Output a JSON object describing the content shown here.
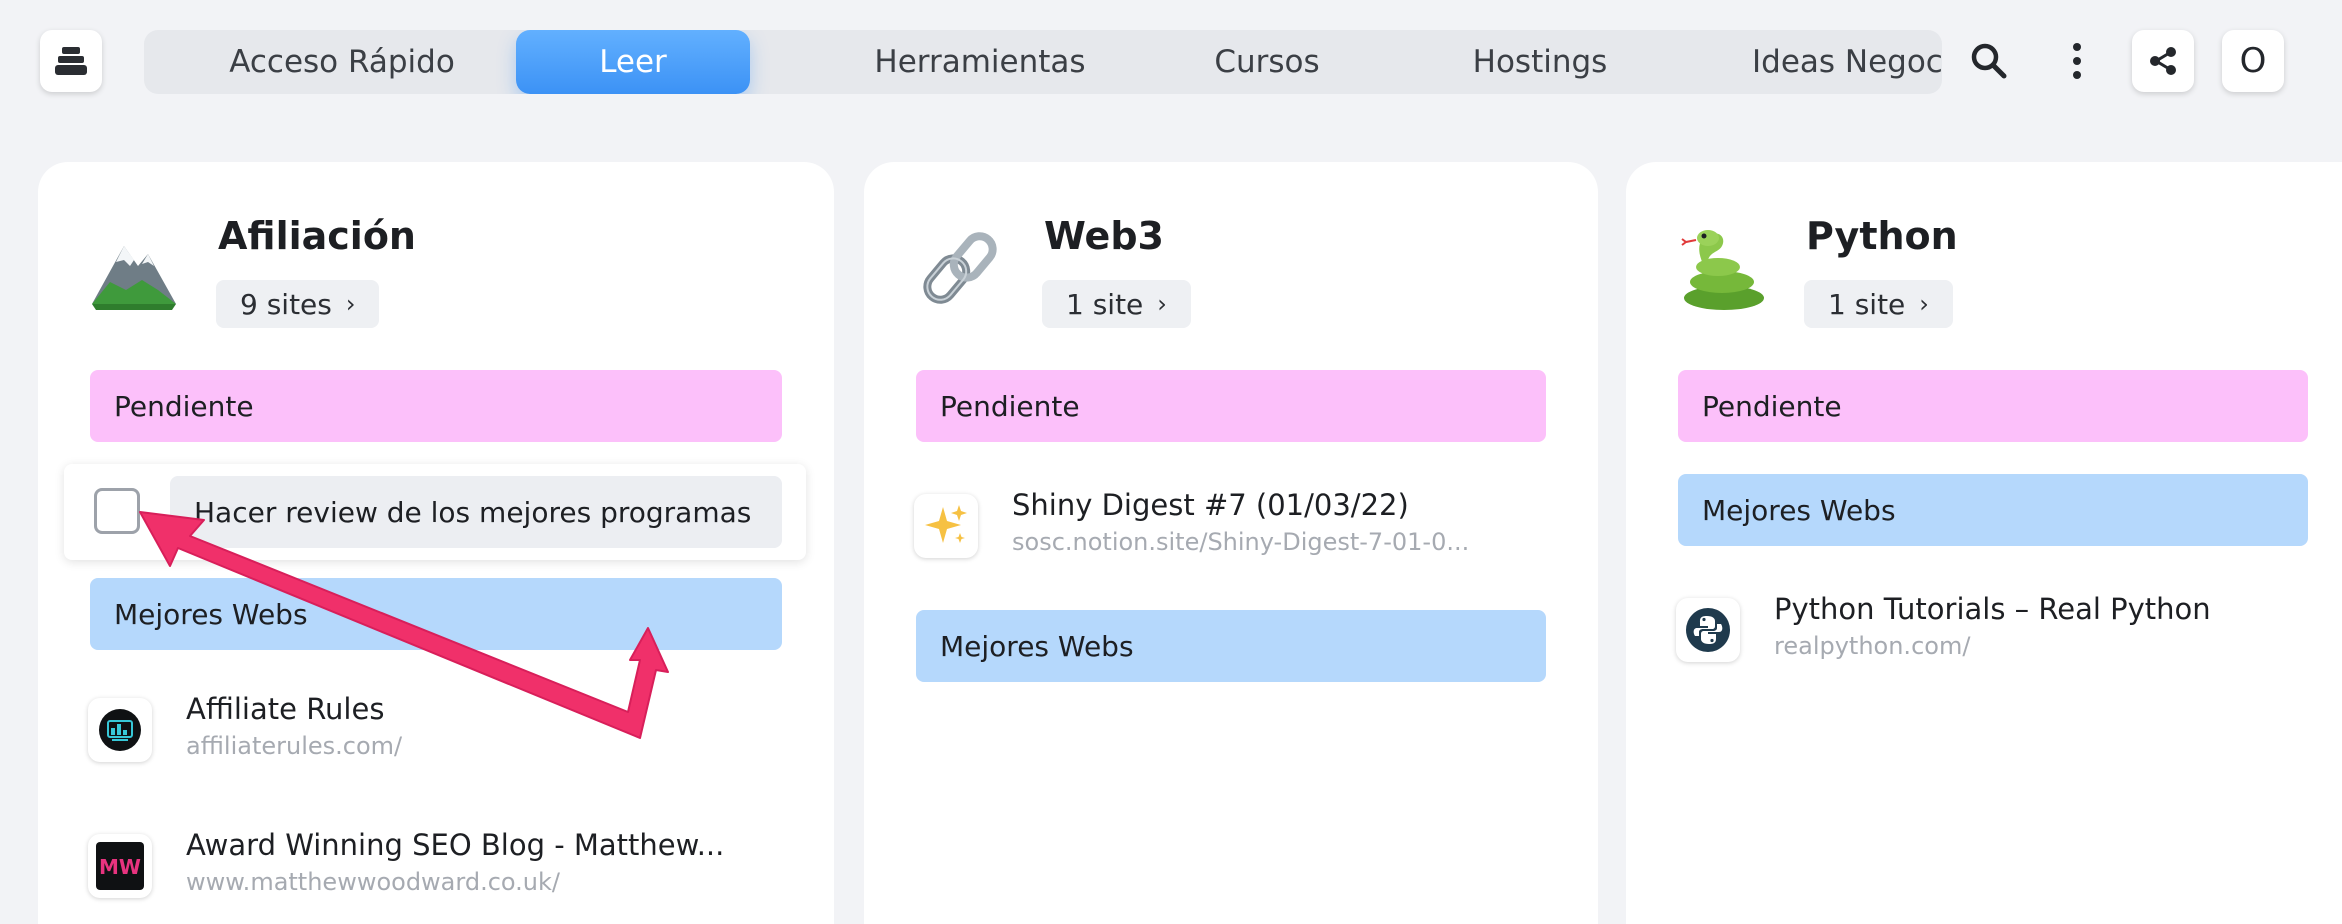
{
  "tabs": [
    {
      "label": "Acceso Rápido",
      "active": false
    },
    {
      "label": "Leer",
      "active": true
    },
    {
      "label": "Herramientas",
      "active": false
    },
    {
      "label": "Cursos",
      "active": false
    },
    {
      "label": "Hostings",
      "active": false
    },
    {
      "label": "Ideas Negocio",
      "active": false
    }
  ],
  "toolbar": {
    "avatar_initial": "O",
    "icons": [
      "stack-icon",
      "search-icon",
      "more-vertical-icon",
      "share-icon"
    ]
  },
  "colors": {
    "accent": "#3c92f5",
    "pink_group": "#fcc0fa",
    "blue_group": "#b5d8fc",
    "annotation_arrow": "#f0306a"
  },
  "columns": [
    {
      "title": "Afiliación",
      "emoji": "mountain-emoji",
      "count_label": "9 sites",
      "groups": [
        "Pendiente",
        "Mejores Webs"
      ],
      "task": "Hacer review de los mejores programas",
      "sites": [
        {
          "title": "Affiliate Rules",
          "url": "affiliaterules.com/",
          "icon": "affiliate-rules-logo"
        },
        {
          "title": "Award Winning SEO Blog - Matthew...",
          "url": "www.matthewwoodward.co.uk/",
          "icon": "mw-logo",
          "icon_text": "MW"
        }
      ]
    },
    {
      "title": "Web3",
      "emoji": "chain-link-emoji",
      "count_label": "1 site",
      "groups": [
        "Pendiente",
        "Mejores Webs"
      ],
      "sites": [
        {
          "title": "Shiny Digest #7 (01/03/22)",
          "url": "sosc.notion.site/Shiny-Digest-7-01-0...",
          "icon": "sparkles-icon"
        }
      ]
    },
    {
      "title": "Python",
      "emoji": "snake-emoji",
      "count_label": "1 site",
      "groups": [
        "Pendiente",
        "Mejores Webs"
      ],
      "sites": [
        {
          "title": "Python Tutorials – Real Python",
          "url": "realpython.com/",
          "icon": "real-python-logo"
        }
      ]
    }
  ]
}
